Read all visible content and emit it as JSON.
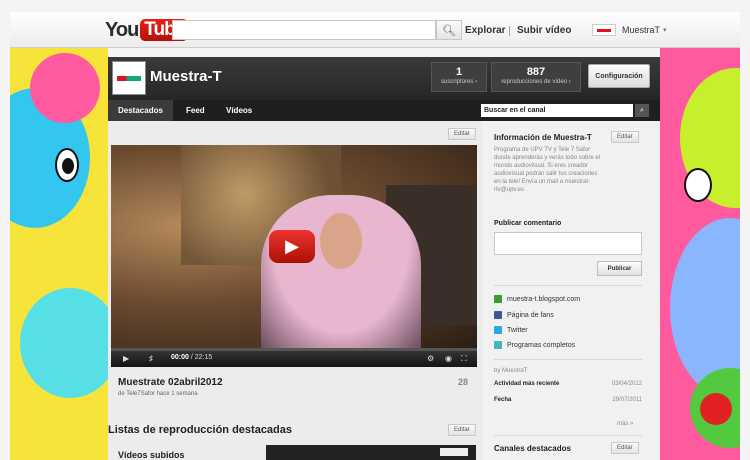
{
  "header": {
    "logo_you": "You",
    "logo_tube": "Tube",
    "search_placeholder": "",
    "nav": [
      "Explorar",
      "Subir vídeo"
    ],
    "user_name": "MuestraT",
    "user_caret": "▾"
  },
  "channel": {
    "name": "Muestra-T",
    "stats": [
      {
        "value": "1",
        "label": "suscriptores ›"
      },
      {
        "value": "887",
        "label": "reproducciones de vídeo ›"
      }
    ],
    "config_label": "Configuración",
    "tabs": [
      "Destacados",
      "Feed",
      "Vídeos"
    ],
    "search_label": "Buscar en el canal",
    "edit_label": "Editar"
  },
  "player": {
    "time_current": "00:00",
    "time_total": "/ 22:15"
  },
  "video": {
    "title": "Muestrate 02abril2012",
    "meta": "de Tele7Safor hace 1 semana",
    "views": "28"
  },
  "playlists": {
    "title": "Listas de reproducción destacadas",
    "edit_label": "Editar",
    "first_label": "Vídeos subidos"
  },
  "sidebar": {
    "info_title": "Información de Muestra-T",
    "edit_label": "Editar",
    "description": "Programa de UPV TV y Tele 7 Safor donde aprenderás y verás todo sobre el mundo audiovisual. Si eres creador audiovisual podrán salir tus creaciones en la tele! Envía un mail a muestrat-rtv@upv.es",
    "comment_label": "Publicar comentario",
    "publish_label": "Publicar",
    "links": [
      {
        "label": "muestra-t.blogspot.com",
        "color": "#3a9b2f"
      },
      {
        "label": "Página de fans",
        "color": "#3b5998"
      },
      {
        "label": "Twitter",
        "color": "#2aa9e0"
      },
      {
        "label": "Programas completos",
        "color": "#44b3c2"
      }
    ],
    "by_line": "by MuestraT",
    "recent_label": "Actividad más reciente",
    "recent_value": "03/04/2012",
    "date_label": "Fecha",
    "date_value": "29/07/2011",
    "more_label": "más »",
    "featured_title": "Canales destacados"
  },
  "colors": {
    "accent_red": "#e62117",
    "header_dark": "#262626"
  }
}
